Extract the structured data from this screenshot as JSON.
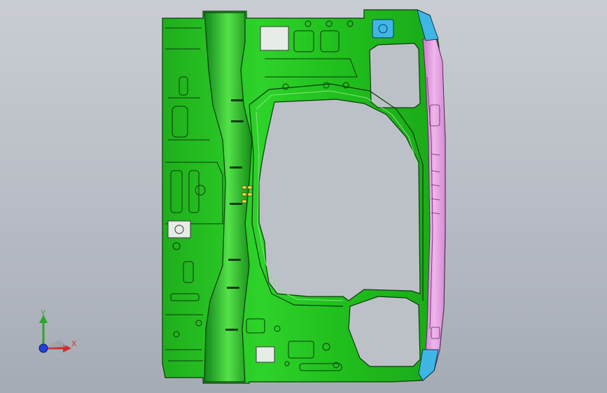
{
  "viewport": {
    "background_top": "#c9cdd3",
    "background_bottom": "#a5abb4"
  },
  "model": {
    "part_color": "#23c21f",
    "part_edge_color": "#0c3a0c",
    "rail_color": "#e79ee0",
    "bracket_color": "#3fb7e6",
    "highlight_color": "#8df07f"
  },
  "triad": {
    "x_label": "X",
    "y_label": "Y",
    "x_color": "#d22c2c",
    "y_color": "#2fa52f",
    "z_color": "#1f3fd6"
  }
}
